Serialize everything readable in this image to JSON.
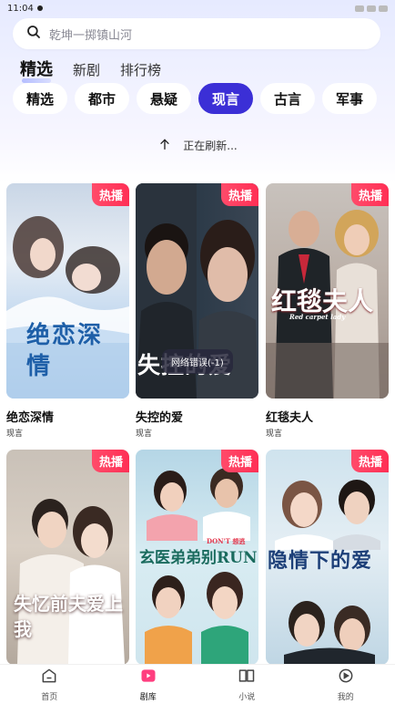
{
  "status": {
    "time": "11:04"
  },
  "search": {
    "placeholder": "乾坤一掷镇山河",
    "icon": "search-icon"
  },
  "main_tabs": [
    {
      "label": "精选",
      "active": true
    },
    {
      "label": "新剧",
      "active": false
    },
    {
      "label": "排行榜",
      "active": false
    }
  ],
  "categories": [
    {
      "label": "精选",
      "active": false
    },
    {
      "label": "都市",
      "active": false
    },
    {
      "label": "悬疑",
      "active": false
    },
    {
      "label": "现言",
      "active": true
    },
    {
      "label": "古言",
      "active": false
    },
    {
      "label": "军事",
      "active": false
    }
  ],
  "refresh": {
    "text": "正在刷新...",
    "icon": "arrow-up-icon"
  },
  "toast": {
    "text": "网络错误(-1)"
  },
  "dramas": [
    {
      "title": "绝恋深情",
      "genre": "现言",
      "badge": "热播",
      "poster_title": "绝恋深情"
    },
    {
      "title": "失控的爱",
      "genre": "现言",
      "badge": "热播",
      "poster_title": "失控的爱"
    },
    {
      "title": "红毯夫人",
      "genre": "现言",
      "badge": "热播",
      "poster_title": "红毯夫人",
      "poster_subtitle": "Red carpet lady"
    },
    {
      "title": "",
      "genre": "",
      "badge": "热播",
      "poster_title": "失忆前夫爱上我"
    },
    {
      "title": "",
      "genre": "",
      "badge": "热播",
      "poster_title": "玄医弟弟别RUN",
      "poster_subtitle": "DON'T 想逃"
    },
    {
      "title": "",
      "genre": "",
      "badge": "热播",
      "poster_title": "隐情下的爱"
    }
  ],
  "bottom_nav": [
    {
      "label": "首页",
      "icon": "home-icon",
      "active": false
    },
    {
      "label": "剧库",
      "icon": "play-library-icon",
      "active": true
    },
    {
      "label": "小说",
      "icon": "book-icon",
      "active": false
    },
    {
      "label": "我的",
      "icon": "profile-icon",
      "active": false
    }
  ],
  "colors": {
    "accent": "#3b2fd6",
    "badge": "#ff2f55"
  }
}
